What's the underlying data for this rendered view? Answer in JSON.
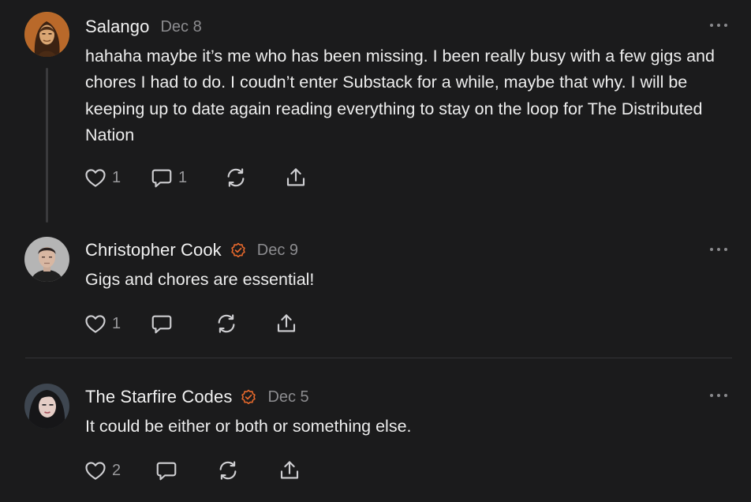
{
  "colors": {
    "background": "#1b1b1c",
    "text": "#ececec",
    "muted": "#8c8c8f",
    "verified_badge": "#e8692c"
  },
  "comments": [
    {
      "author": "Salango",
      "date": "Dec 8",
      "verified": false,
      "text": "hahaha maybe it’s me who has been missing. I been really busy with a few gigs and chores I had to do. I coudn’t enter Substack for a while, maybe that why. I will be keeping up to date again reading everything to stay on the loop for The Distributed Nation",
      "like_count": "1",
      "reply_count": "1",
      "icons": [
        "heart-icon",
        "comment-icon",
        "restack-icon",
        "share-icon",
        "more-icon"
      ]
    },
    {
      "author": "Christopher Cook",
      "date": "Dec 9",
      "verified": true,
      "text": "Gigs and chores are essential!",
      "like_count": "1",
      "reply_count": "",
      "icons": [
        "heart-icon",
        "comment-icon",
        "restack-icon",
        "share-icon",
        "more-icon"
      ]
    },
    {
      "author": "The Starfire Codes",
      "date": "Dec 5",
      "verified": true,
      "text": "It could be either or both or something else.",
      "like_count": "2",
      "reply_count": "",
      "icons": [
        "heart-icon",
        "comment-icon",
        "restack-icon",
        "share-icon",
        "more-icon"
      ]
    }
  ]
}
